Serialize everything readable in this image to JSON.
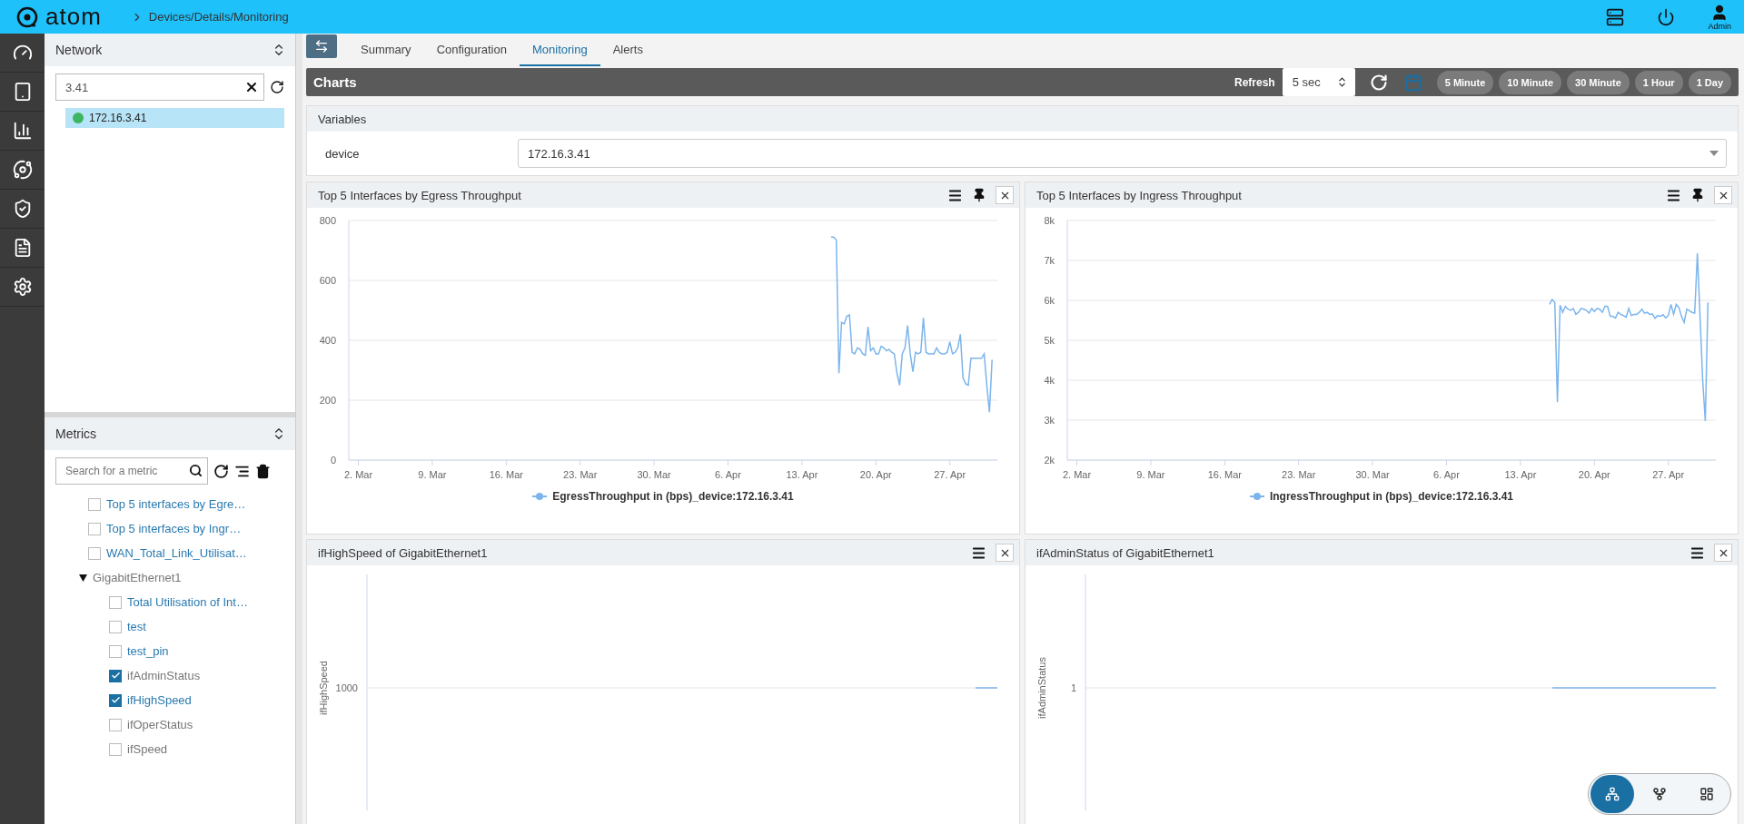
{
  "app": {
    "logo": "atom",
    "breadcrumb": "Devices/Details/Monitoring",
    "user": "Admin"
  },
  "network": {
    "title": "Network",
    "search": {
      "value": "3.41"
    },
    "items": [
      {
        "label": "172.16.3.41",
        "color": "#3cb660",
        "selected": true
      }
    ]
  },
  "metrics": {
    "title": "Metrics",
    "search": {
      "placeholder": "Search for a metric"
    },
    "tree": [
      {
        "kind": "item",
        "label": "Top 5 interfaces by Egre…",
        "checked": false,
        "dimmed": false
      },
      {
        "kind": "item",
        "label": "Top 5 interfaces by Ingr…",
        "checked": false,
        "dimmed": false
      },
      {
        "kind": "item",
        "label": "WAN_Total_Link_Utilisat…",
        "checked": false,
        "dimmed": false
      },
      {
        "kind": "group",
        "label": "GigabitEthernet1",
        "expanded": true,
        "children": [
          {
            "kind": "item",
            "label": "Total Utilisation of Int…",
            "checked": false,
            "dimmed": false
          },
          {
            "kind": "item",
            "label": "test",
            "checked": false,
            "dimmed": false
          },
          {
            "kind": "item",
            "label": "test_pin",
            "checked": false,
            "dimmed": false
          },
          {
            "kind": "item",
            "label": "ifAdminStatus",
            "checked": true,
            "dimmed": true
          },
          {
            "kind": "item",
            "label": "ifHighSpeed",
            "checked": true,
            "dimmed": false
          },
          {
            "kind": "item",
            "label": "ifOperStatus",
            "checked": false,
            "dimmed": true
          },
          {
            "kind": "item",
            "label": "ifSpeed",
            "checked": false,
            "dimmed": true
          }
        ]
      }
    ]
  },
  "tabs": [
    {
      "label": "Summary",
      "selected": false
    },
    {
      "label": "Configuration",
      "selected": false
    },
    {
      "label": "Monitoring",
      "selected": true
    },
    {
      "label": "Alerts",
      "selected": false
    }
  ],
  "charts_bar": {
    "title": "Charts",
    "refresh_label": "Refresh",
    "refresh_value": "5 sec",
    "ranges": [
      "5 Minute",
      "10 Minute",
      "30 Minute",
      "1 Hour",
      "1 Day"
    ]
  },
  "variables": {
    "title": "Variables",
    "fields": [
      {
        "label": "device",
        "value": "172.16.3.41"
      }
    ]
  },
  "panels": [
    {
      "kind": "line",
      "pin": true,
      "chart_data": {
        "type": "line",
        "title": "Top 5 Interfaces by Egress Throughput",
        "grid": true,
        "ylim": [
          0,
          800
        ],
        "yticks": [
          0,
          200,
          400,
          600,
          800
        ],
        "categories": [
          "2. Mar",
          null,
          null,
          null,
          null,
          null,
          null,
          null,
          null,
          null,
          null,
          null,
          null,
          null,
          null,
          null,
          null,
          null,
          null,
          null,
          null,
          null,
          null,
          null,
          null,
          null,
          null,
          null,
          "9. Mar",
          null,
          null,
          null,
          null,
          null,
          null,
          null,
          null,
          null,
          null,
          null,
          null,
          null,
          null,
          null,
          null,
          null,
          null,
          null,
          null,
          null,
          null,
          null,
          null,
          null,
          null,
          null,
          "16. Mar",
          null,
          null,
          null,
          null,
          null,
          null,
          null,
          null,
          null,
          null,
          null,
          null,
          null,
          null,
          null,
          null,
          null,
          null,
          null,
          null,
          null,
          null,
          null,
          null,
          null,
          null,
          null,
          "23. Mar",
          null,
          null,
          null,
          null,
          null,
          null,
          null,
          null,
          null,
          null,
          null,
          null,
          null,
          null,
          null,
          null,
          null,
          null,
          null,
          null,
          null,
          null,
          null,
          null,
          null,
          null,
          null,
          "30. Mar",
          null,
          null,
          null,
          null,
          null,
          null,
          null,
          null,
          null,
          null,
          null,
          null,
          null,
          null,
          null,
          null,
          null,
          null,
          null,
          null,
          null,
          null,
          null,
          null,
          null,
          null,
          null,
          "6. Apr",
          null,
          null,
          null,
          null,
          null,
          null,
          null,
          null,
          null,
          null,
          null,
          null,
          null,
          null,
          null,
          null,
          null,
          null,
          null,
          null,
          null,
          null,
          null,
          null,
          null,
          null,
          null,
          "13. Apr",
          null,
          null,
          null,
          null,
          null,
          null,
          null,
          null,
          null,
          null,
          null,
          null,
          null,
          null,
          null,
          null,
          null,
          null,
          null,
          null,
          null,
          null,
          null,
          null,
          null,
          null,
          null,
          "20. Apr",
          null,
          null,
          null,
          null,
          null,
          null,
          null,
          null,
          null,
          null,
          null,
          null,
          null,
          null,
          null,
          null,
          null,
          null,
          null,
          null,
          null,
          null,
          null,
          null,
          null,
          null,
          null,
          "27. Apr",
          null,
          null,
          null,
          null,
          null,
          null,
          null,
          null,
          null,
          null,
          null,
          null,
          null,
          null,
          null,
          null
        ],
        "series": [
          {
            "name": "EgressThroughput in (bps)_device:172.16.3.41",
            "color": "#7cb5ec",
            "values": [
              null,
              null,
              null,
              null,
              null,
              null,
              null,
              null,
              null,
              null,
              null,
              null,
              null,
              null,
              null,
              null,
              null,
              null,
              null,
              null,
              null,
              null,
              null,
              null,
              null,
              null,
              null,
              null,
              null,
              null,
              null,
              null,
              null,
              null,
              null,
              null,
              null,
              null,
              null,
              null,
              null,
              null,
              null,
              null,
              null,
              null,
              null,
              null,
              null,
              null,
              null,
              null,
              null,
              null,
              null,
              null,
              null,
              null,
              null,
              null,
              null,
              null,
              null,
              null,
              null,
              null,
              null,
              null,
              null,
              null,
              null,
              null,
              null,
              null,
              null,
              null,
              null,
              null,
              null,
              null,
              null,
              null,
              null,
              null,
              null,
              null,
              null,
              null,
              null,
              null,
              null,
              null,
              null,
              null,
              null,
              null,
              null,
              null,
              null,
              null,
              null,
              null,
              null,
              null,
              null,
              null,
              null,
              null,
              null,
              null,
              null,
              null,
              null,
              null,
              null,
              null,
              null,
              null,
              null,
              null,
              null,
              null,
              null,
              null,
              null,
              null,
              null,
              null,
              null,
              null,
              null,
              null,
              null,
              null,
              null,
              null,
              null,
              null,
              null,
              null,
              null,
              null,
              null,
              null,
              null,
              null,
              null,
              null,
              null,
              null,
              null,
              null,
              null,
              null,
              null,
              null,
              null,
              null,
              null,
              null,
              null,
              null,
              null,
              null,
              null,
              null,
              null,
              null,
              null,
              null,
              null,
              null,
              null,
              null,
              null,
              null,
              null,
              null,
              null,
              745,
              745,
              735,
              290,
              460,
              455,
              480,
              485,
              360,
              355,
              375,
              370,
              355,
              350,
              445,
              365,
              375,
              355,
              355,
              380,
              375,
              365,
              370,
              360,
              355,
              290,
              250,
              355,
              375,
              450,
              355,
              295,
              360,
              355,
              360,
              475,
              360,
              355,
              355,
              355,
              375,
              360,
              355,
              355,
              360,
              395,
              355,
              360,
              375,
              420,
              275,
              255,
              250,
              340,
              340,
              340,
              340,
              340,
              355,
              250,
              160,
              335
            ]
          }
        ]
      }
    },
    {
      "kind": "line",
      "pin": true,
      "chart_data": {
        "type": "line",
        "title": "Top 5 Interfaces by Ingress Throughput",
        "grid": true,
        "ylim": [
          2000,
          8000
        ],
        "yticks": [
          {
            "value": 2000,
            "label": "2k"
          },
          {
            "value": 3000,
            "label": "3k"
          },
          {
            "value": 4000,
            "label": "4k"
          },
          {
            "value": 5000,
            "label": "5k"
          },
          {
            "value": 6000,
            "label": "6k"
          },
          {
            "value": 7000,
            "label": "7k"
          },
          {
            "value": 8000,
            "label": "8k"
          }
        ],
        "categories": [
          "2. Mar",
          null,
          null,
          null,
          null,
          null,
          null,
          null,
          null,
          null,
          null,
          null,
          null,
          null,
          null,
          null,
          null,
          null,
          null,
          null,
          null,
          null,
          null,
          null,
          null,
          null,
          null,
          null,
          "9. Mar",
          null,
          null,
          null,
          null,
          null,
          null,
          null,
          null,
          null,
          null,
          null,
          null,
          null,
          null,
          null,
          null,
          null,
          null,
          null,
          null,
          null,
          null,
          null,
          null,
          null,
          null,
          null,
          "16. Mar",
          null,
          null,
          null,
          null,
          null,
          null,
          null,
          null,
          null,
          null,
          null,
          null,
          null,
          null,
          null,
          null,
          null,
          null,
          null,
          null,
          null,
          null,
          null,
          null,
          null,
          null,
          null,
          "23. Mar",
          null,
          null,
          null,
          null,
          null,
          null,
          null,
          null,
          null,
          null,
          null,
          null,
          null,
          null,
          null,
          null,
          null,
          null,
          null,
          null,
          null,
          null,
          null,
          null,
          null,
          null,
          null,
          "30. Mar",
          null,
          null,
          null,
          null,
          null,
          null,
          null,
          null,
          null,
          null,
          null,
          null,
          null,
          null,
          null,
          null,
          null,
          null,
          null,
          null,
          null,
          null,
          null,
          null,
          null,
          null,
          null,
          "6. Apr",
          null,
          null,
          null,
          null,
          null,
          null,
          null,
          null,
          null,
          null,
          null,
          null,
          null,
          null,
          null,
          null,
          null,
          null,
          null,
          null,
          null,
          null,
          null,
          null,
          null,
          null,
          null,
          "13. Apr",
          null,
          null,
          null,
          null,
          null,
          null,
          null,
          null,
          null,
          null,
          null,
          null,
          null,
          null,
          null,
          null,
          null,
          null,
          null,
          null,
          null,
          null,
          null,
          null,
          null,
          null,
          null,
          "20. Apr",
          null,
          null,
          null,
          null,
          null,
          null,
          null,
          null,
          null,
          null,
          null,
          null,
          null,
          null,
          null,
          null,
          null,
          null,
          null,
          null,
          null,
          null,
          null,
          null,
          null,
          null,
          null,
          "27. Apr",
          null,
          null,
          null,
          null,
          null,
          null,
          null,
          null,
          null,
          null,
          null,
          null,
          null,
          null,
          null,
          null
        ],
        "series": [
          {
            "name": "IngressThroughput in (bps)_device:172.16.3.41",
            "color": "#7cb5ec",
            "values": [
              null,
              null,
              null,
              null,
              null,
              null,
              null,
              null,
              null,
              null,
              null,
              null,
              null,
              null,
              null,
              null,
              null,
              null,
              null,
              null,
              null,
              null,
              null,
              null,
              null,
              null,
              null,
              null,
              null,
              null,
              null,
              null,
              null,
              null,
              null,
              null,
              null,
              null,
              null,
              null,
              null,
              null,
              null,
              null,
              null,
              null,
              null,
              null,
              null,
              null,
              null,
              null,
              null,
              null,
              null,
              null,
              null,
              null,
              null,
              null,
              null,
              null,
              null,
              null,
              null,
              null,
              null,
              null,
              null,
              null,
              null,
              null,
              null,
              null,
              null,
              null,
              null,
              null,
              null,
              null,
              null,
              null,
              null,
              null,
              null,
              null,
              null,
              null,
              null,
              null,
              null,
              null,
              null,
              null,
              null,
              null,
              null,
              null,
              null,
              null,
              null,
              null,
              null,
              null,
              null,
              null,
              null,
              null,
              null,
              null,
              null,
              null,
              null,
              null,
              null,
              null,
              null,
              null,
              null,
              null,
              null,
              null,
              null,
              null,
              null,
              null,
              null,
              null,
              null,
              null,
              null,
              null,
              null,
              null,
              null,
              null,
              null,
              null,
              null,
              null,
              null,
              null,
              null,
              null,
              null,
              null,
              null,
              null,
              null,
              null,
              null,
              null,
              null,
              null,
              null,
              null,
              null,
              null,
              null,
              null,
              null,
              null,
              null,
              null,
              null,
              null,
              null,
              null,
              null,
              null,
              null,
              null,
              null,
              null,
              null,
              null,
              null,
              null,
              null,
              5900,
              6020,
              5950,
              3450,
              5880,
              5700,
              5850,
              5780,
              5750,
              5800,
              5650,
              5700,
              5800,
              5780,
              5750,
              5680,
              5800,
              5720,
              5800,
              5780,
              5700,
              5850,
              5850,
              5600,
              5600,
              5560,
              5700,
              5650,
              5620,
              5580,
              5800,
              5620,
              5650,
              5650,
              5700,
              5780,
              5680,
              5700,
              5650,
              5660,
              5550,
              5620,
              5600,
              5640,
              5560,
              5620,
              5900,
              5650,
              5900,
              5820,
              5600,
              5450,
              5780,
              5740,
              5700,
              5680,
              7180,
              5600,
              4000,
              2980,
              5950,
              null
            ]
          }
        ]
      }
    },
    {
      "kind": "single",
      "pin": false,
      "title": "ifHighSpeed of GigabitEthernet1",
      "y_label": "ifHighSpeed",
      "y_tick": "1000"
    },
    {
      "kind": "single",
      "pin": false,
      "title": "ifAdminStatus of GigabitEthernet1",
      "y_label": "ifAdminStatus",
      "y_tick": "1"
    }
  ],
  "view_switcher": [
    {
      "selected": true
    },
    {
      "selected": false
    },
    {
      "selected": false
    }
  ]
}
